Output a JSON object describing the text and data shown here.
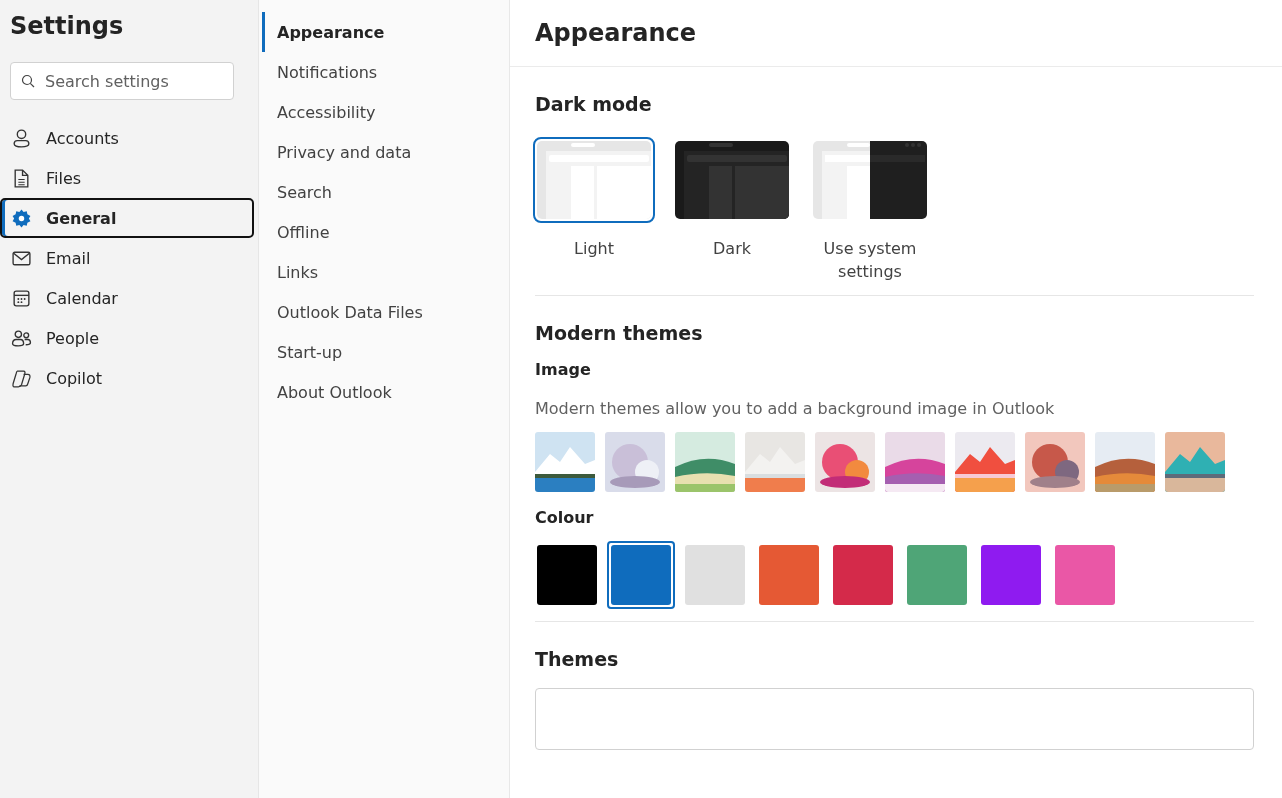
{
  "sidebar": {
    "title": "Settings",
    "search": {
      "placeholder": "Search settings"
    },
    "items": [
      {
        "label": "Accounts",
        "kind": "person",
        "selected": false
      },
      {
        "label": "Files",
        "kind": "file",
        "selected": false
      },
      {
        "label": "General",
        "kind": "gear",
        "selected": true
      },
      {
        "label": "Email",
        "kind": "mail",
        "selected": false
      },
      {
        "label": "Calendar",
        "kind": "calendar",
        "selected": false
      },
      {
        "label": "People",
        "kind": "people",
        "selected": false
      },
      {
        "label": "Copilot",
        "kind": "copilot",
        "selected": false
      }
    ]
  },
  "subnav": {
    "items": [
      {
        "label": "Appearance",
        "selected": true
      },
      {
        "label": "Notifications",
        "selected": false
      },
      {
        "label": "Accessibility",
        "selected": false
      },
      {
        "label": "Privacy and data",
        "selected": false
      },
      {
        "label": "Search",
        "selected": false
      },
      {
        "label": "Offline",
        "selected": false
      },
      {
        "label": "Links",
        "selected": false
      },
      {
        "label": "Outlook Data Files",
        "selected": false
      },
      {
        "label": "Start-up",
        "selected": false
      },
      {
        "label": "About Outlook",
        "selected": false
      }
    ]
  },
  "main": {
    "title": "Appearance",
    "dark_mode": {
      "heading": "Dark mode",
      "options": [
        {
          "label": "Light",
          "kind": "light",
          "selected": true
        },
        {
          "label": "Dark",
          "kind": "dark",
          "selected": false
        },
        {
          "label": "Use system settings",
          "kind": "system",
          "selected": false
        }
      ]
    },
    "modern_themes": {
      "heading": "Modern themes",
      "image_heading": "Image",
      "description": "Modern themes allow you to add a background image in Outlook",
      "colour_heading": "Colour",
      "colours": [
        {
          "color": "#000000",
          "selected": false
        },
        {
          "color": "#0f6cbd",
          "selected": true
        },
        {
          "color": "#e0e0e0",
          "selected": false
        },
        {
          "color": "#e55934",
          "selected": false
        },
        {
          "color": "#d42a4a",
          "selected": false
        },
        {
          "color": "#4fa577",
          "selected": false
        },
        {
          "color": "#8f1bf0",
          "selected": false
        },
        {
          "color": "#ea57a6",
          "selected": false
        }
      ]
    },
    "themes": {
      "heading": "Themes"
    }
  }
}
